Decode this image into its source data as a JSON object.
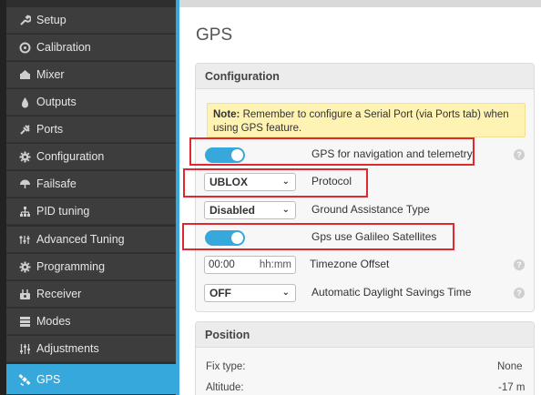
{
  "sidebar": {
    "items": [
      {
        "label": "Setup",
        "icon": "wrench-icon"
      },
      {
        "label": "Calibration",
        "icon": "crosshair-icon"
      },
      {
        "label": "Mixer",
        "icon": "mixer-icon"
      },
      {
        "label": "Outputs",
        "icon": "flame-icon"
      },
      {
        "label": "Ports",
        "icon": "plug-icon"
      },
      {
        "label": "Configuration",
        "icon": "gear-icon"
      },
      {
        "label": "Failsafe",
        "icon": "umbrella-icon"
      },
      {
        "label": "PID tuning",
        "icon": "hierarchy-icon"
      },
      {
        "label": "Advanced Tuning",
        "icon": "tuning-icon"
      },
      {
        "label": "Programming",
        "icon": "gear-icon"
      },
      {
        "label": "Receiver",
        "icon": "receiver-icon"
      },
      {
        "label": "Modes",
        "icon": "modes-icon"
      },
      {
        "label": "Adjustments",
        "icon": "sliders-icon"
      },
      {
        "label": "GPS",
        "icon": "satellite-icon",
        "active": true
      }
    ],
    "accent_color": "#37a8db"
  },
  "main": {
    "title": "GPS",
    "configuration": {
      "heading": "Configuration",
      "note_bold": "Note:",
      "note_text": " Remember to configure a Serial Port (via Ports tab) when using GPS feature.",
      "gps_nav_label": "GPS for navigation and telemetry",
      "gps_nav_enabled": true,
      "protocol_value": "UBLOX",
      "protocol_label": "Protocol",
      "ground_assist_value": "Disabled",
      "ground_assist_label": "Ground Assistance Type",
      "galileo_label": "Gps use Galileo Satellites",
      "galileo_enabled": true,
      "tz_value": "00:00",
      "tz_placeholder": "hh:mm",
      "tz_label": "Timezone Offset",
      "dst_value": "OFF",
      "dst_label": "Automatic Daylight Savings Time"
    },
    "position": {
      "heading": "Position",
      "fix_label": "Fix type:",
      "fix_value": "None",
      "alt_label": "Altitude:",
      "alt_value": "-17 m"
    }
  },
  "highlight_color": "#e0282e"
}
